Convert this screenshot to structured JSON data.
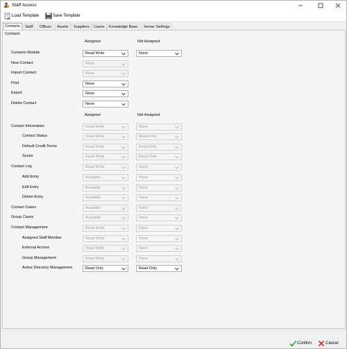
{
  "window": {
    "title": "Staff Access"
  },
  "toolbar": {
    "load_label": "Load Template",
    "save_label": "Save Template"
  },
  "tabs": [
    "Contacts",
    "Staff",
    "Offices",
    "Assets",
    "Suppliers",
    "Cases",
    "Knowledge Base",
    "Server Settings"
  ],
  "active_tab": "Contacts",
  "section": {
    "label": "Contacts"
  },
  "columns": {
    "assigned": "Assigned",
    "not_assigned": "Not Assigned"
  },
  "group1": [
    {
      "label": "Contacts Module",
      "assigned": "Read Write",
      "not_assigned": "None"
    },
    {
      "label": "New Contact",
      "assigned": "None"
    },
    {
      "label": "Import Contact",
      "assigned": "None"
    },
    {
      "label": "Print",
      "assigned": "None"
    },
    {
      "label": "Export",
      "assigned": "None"
    },
    {
      "label": "Delete Contact",
      "assigned": "None"
    }
  ],
  "group2": [
    {
      "label": "Contact Information",
      "assigned": "Read Write",
      "not_assigned": "None"
    },
    {
      "label": "Contact Status",
      "assigned": "Read Write",
      "not_assigned": "Read Only"
    },
    {
      "label": "Default Credit Terms",
      "assigned": "Read Write",
      "not_assigned": "Read Only"
    },
    {
      "label": "Sector",
      "assigned": "Read Write",
      "not_assigned": "Read Only"
    },
    {
      "label": "Contact Log",
      "assigned": "Read Write",
      "not_assigned": "None"
    },
    {
      "label": "Add Entry",
      "assigned": "Available",
      "not_assigned": "None"
    },
    {
      "label": "Edit Entry",
      "assigned": "Available",
      "not_assigned": "None"
    },
    {
      "label": "Delete Entry",
      "assigned": "Available",
      "not_assigned": "None"
    },
    {
      "label": "Contact Cases",
      "assigned": "Available",
      "not_assigned": "None"
    },
    {
      "label": "Group Cases",
      "assigned": "Available",
      "not_assigned": "None"
    },
    {
      "label": "Contact Management",
      "assigned": "Read Write",
      "not_assigned": "None"
    },
    {
      "label": "Assigned Staff Member",
      "assigned": "Read Write",
      "not_assigned": "None"
    },
    {
      "label": "External Access",
      "assigned": "Read Write",
      "not_assigned": "None"
    },
    {
      "label": "Group Management",
      "assigned": "Read Write",
      "not_assigned": "None"
    },
    {
      "label": "Active Directory Management",
      "assigned": "Read Only",
      "not_assigned": "Read Only"
    }
  ],
  "footer": {
    "confirm_label": "Confirm",
    "cancel_label": "Cancel"
  },
  "colors": {
    "confirm_green": "#2e9e3a",
    "cancel_red": "#d42b2b"
  }
}
